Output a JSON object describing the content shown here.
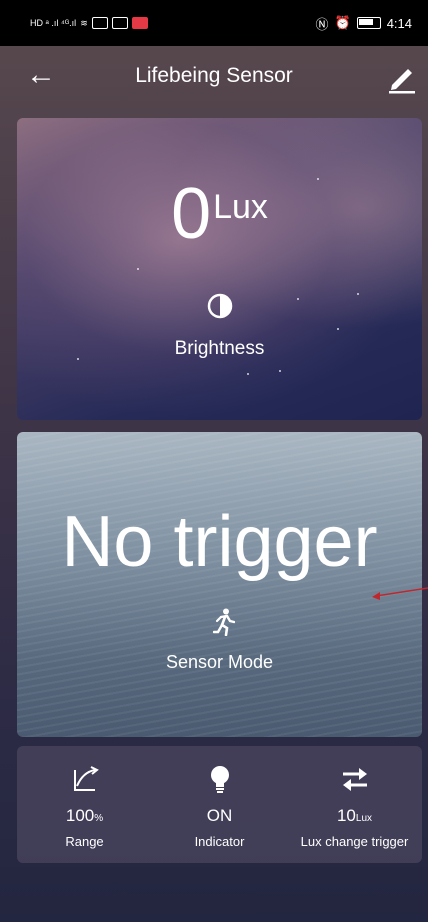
{
  "status_bar": {
    "time": "4:14"
  },
  "header": {
    "title": "Lifebeing Sensor"
  },
  "brightness": {
    "value": "0",
    "unit": "Lux",
    "label": "Brightness"
  },
  "sensor": {
    "state": "No trigger",
    "label": "Sensor Mode"
  },
  "stats": [
    {
      "value": "100",
      "unit": "%",
      "label": "Range",
      "icon": "range-icon"
    },
    {
      "value": "ON",
      "unit": "",
      "label": "Indicator",
      "icon": "bulb-icon"
    },
    {
      "value": "10",
      "unit": "Lux",
      "label": "Lux change trigger",
      "icon": "swap-arrows-icon"
    }
  ],
  "colors": {
    "annotation_arrow": "#c0272d",
    "status_icon_red": "#e53945"
  }
}
